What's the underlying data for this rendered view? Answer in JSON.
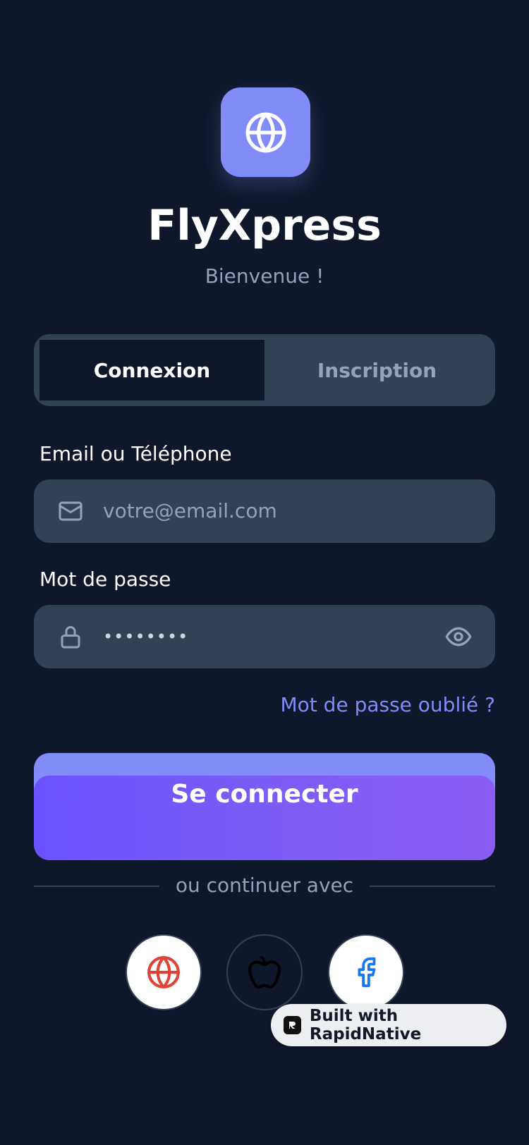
{
  "app": {
    "name": "FlyXpress",
    "welcome": "Bienvenue !",
    "logo_icon": "globe-icon"
  },
  "tabs": [
    {
      "label": "Connexion",
      "active": true
    },
    {
      "label": "Inscription",
      "active": false
    }
  ],
  "form": {
    "email_label": "Email ou Téléphone",
    "email_placeholder": "votre@email.com",
    "email_icon": "mail-icon",
    "password_label": "Mot de passe",
    "password_value": "••••••••",
    "password_icon": "lock-icon",
    "toggle_visibility_icon": "eye-icon",
    "forgot_password": "Mot de passe oublié ?",
    "submit_label": "Se connecter"
  },
  "social": {
    "divider_text": "ou continuer avec",
    "providers": [
      {
        "icon": "globe-icon",
        "color": "#db4437"
      },
      {
        "icon": "apple-icon",
        "color": "#000000"
      },
      {
        "icon": "facebook-icon",
        "color": "#1877f2"
      }
    ]
  },
  "badge": {
    "text": "Built with RapidNative"
  },
  "colors": {
    "background": "#0f172a",
    "surface": "#334155",
    "accent": "#818cf8",
    "button_gradient_start": "#6a52ff",
    "button_gradient_end": "#8b5cf6",
    "muted_text": "#94a3b8"
  }
}
